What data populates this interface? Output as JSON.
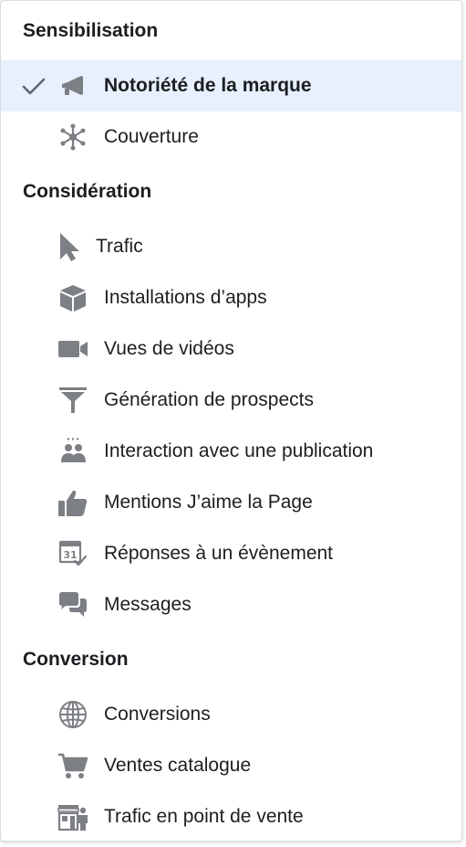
{
  "colors": {
    "icon": "#7c7f84",
    "text": "#1c1e21",
    "selected_bg": "#e7f0fc"
  },
  "sections": [
    {
      "title": "Sensibilisation",
      "items": [
        {
          "label": "Notoriété de la marque",
          "icon": "megaphone-icon",
          "selected": true
        },
        {
          "label": "Couverture",
          "icon": "reach-icon",
          "selected": false
        }
      ]
    },
    {
      "title": "Considération",
      "items": [
        {
          "label": "Trafic",
          "icon": "cursor-icon",
          "selected": false
        },
        {
          "label": "Installations d’apps",
          "icon": "box-icon",
          "selected": false
        },
        {
          "label": "Vues de vidéos",
          "icon": "video-camera-icon",
          "selected": false
        },
        {
          "label": "Génération de prospects",
          "icon": "funnel-icon",
          "selected": false
        },
        {
          "label": "Interaction avec une publication",
          "icon": "people-icon",
          "selected": false
        },
        {
          "label": "Mentions J’aime la Page",
          "icon": "thumbs-up-icon",
          "selected": false
        },
        {
          "label": "Réponses à un évènement",
          "icon": "calendar-icon",
          "selected": false
        },
        {
          "label": "Messages",
          "icon": "chat-bubbles-icon",
          "selected": false
        }
      ]
    },
    {
      "title": "Conversion",
      "items": [
        {
          "label": "Conversions",
          "icon": "globe-icon",
          "selected": false
        },
        {
          "label": "Ventes catalogue",
          "icon": "shopping-cart-icon",
          "selected": false
        },
        {
          "label": "Trafic en point de vente",
          "icon": "storefront-icon",
          "selected": false
        }
      ]
    }
  ]
}
